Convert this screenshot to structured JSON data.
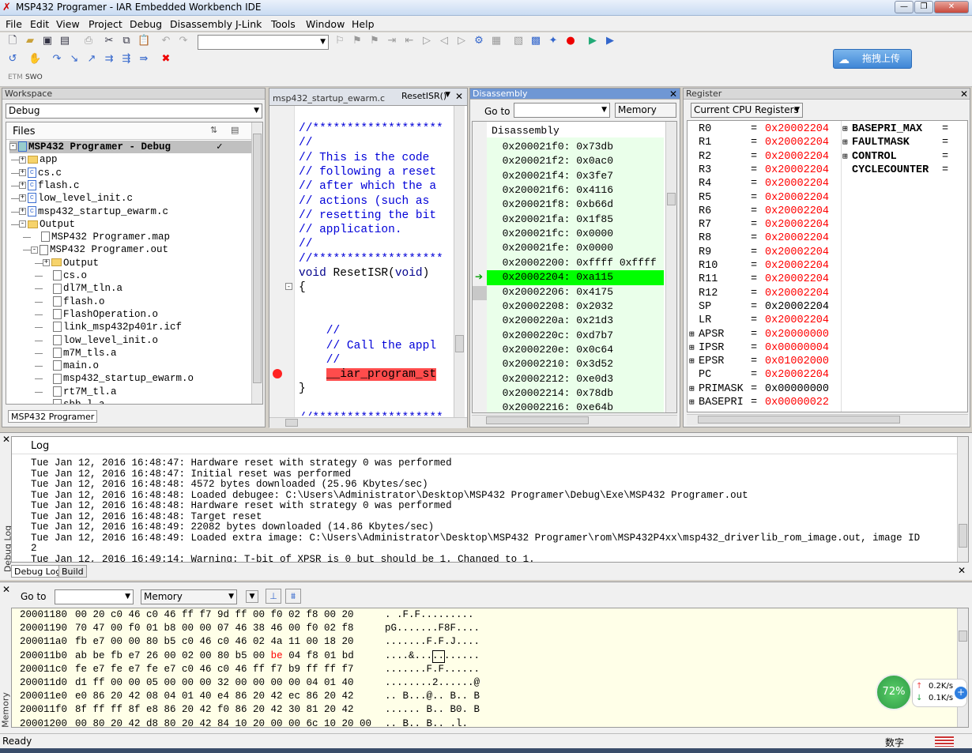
{
  "window": {
    "title": "MSP432 Programer - IAR Embedded Workbench IDE",
    "min": "—",
    "max": "❐",
    "close": "✕"
  },
  "menu": [
    "File",
    "Edit",
    "View",
    "Project",
    "Debug",
    "Disassembly",
    "J-Link",
    "Tools",
    "Window",
    "Help"
  ],
  "upload_button": "拖拽上传",
  "etm_tabs": [
    "ETM",
    "SWO"
  ],
  "workspace": {
    "header": "Workspace",
    "config": "Debug",
    "files_label": "Files",
    "root": "MSP432 Programer - Debug",
    "check": "✓",
    "bottom_tab": "MSP432 Programer",
    "items": [
      {
        "name": "app",
        "kind": "folder",
        "indent": 0,
        "pm": "+"
      },
      {
        "name": "cs.c",
        "kind": "c",
        "indent": 0,
        "pm": "+"
      },
      {
        "name": "flash.c",
        "kind": "c",
        "indent": 0,
        "pm": "+"
      },
      {
        "name": "low_level_init.c",
        "kind": "c",
        "indent": 0,
        "pm": "+"
      },
      {
        "name": "msp432_startup_ewarm.c",
        "kind": "c",
        "indent": 0,
        "pm": "+"
      },
      {
        "name": "Output",
        "kind": "folder",
        "indent": 0,
        "pm": "-"
      },
      {
        "name": "MSP432 Programer.map",
        "kind": "file",
        "indent": 1,
        "pm": ""
      },
      {
        "name": "MSP432 Programer.out",
        "kind": "file",
        "indent": 1,
        "pm": "-"
      },
      {
        "name": "Output",
        "kind": "folder",
        "indent": 2,
        "pm": "+"
      },
      {
        "name": "cs.o",
        "kind": "file",
        "indent": 2,
        "pm": ""
      },
      {
        "name": "dl7M_tln.a",
        "kind": "file",
        "indent": 2,
        "pm": ""
      },
      {
        "name": "flash.o",
        "kind": "file",
        "indent": 2,
        "pm": ""
      },
      {
        "name": "FlashOperation.o",
        "kind": "file",
        "indent": 2,
        "pm": ""
      },
      {
        "name": "link_msp432p401r.icf",
        "kind": "file",
        "indent": 2,
        "pm": ""
      },
      {
        "name": "low_level_init.o",
        "kind": "file",
        "indent": 2,
        "pm": ""
      },
      {
        "name": "m7M_tls.a",
        "kind": "file",
        "indent": 2,
        "pm": ""
      },
      {
        "name": "main.o",
        "kind": "file",
        "indent": 2,
        "pm": ""
      },
      {
        "name": "msp432_startup_ewarm.o",
        "kind": "file",
        "indent": 2,
        "pm": ""
      },
      {
        "name": "rt7M_tl.a",
        "kind": "file",
        "indent": 2,
        "pm": ""
      },
      {
        "name": "shb_l.a",
        "kind": "file",
        "indent": 2,
        "pm": ""
      }
    ]
  },
  "editor": {
    "tab": "msp432_startup_ewarm.c",
    "func_combo": "ResetISR()",
    "close": "✕",
    "lines": [
      {
        "t": "//*******************",
        "c": "cm"
      },
      {
        "t": "//",
        "c": "cm"
      },
      {
        "t": "// This is the code",
        "c": "cm"
      },
      {
        "t": "// following a reset",
        "c": "cm"
      },
      {
        "t": "// after which the a",
        "c": "cm"
      },
      {
        "t": "// actions (such as ",
        "c": "cm"
      },
      {
        "t": "// resetting the bit",
        "c": "cm"
      },
      {
        "t": "// application.",
        "c": "cm"
      },
      {
        "t": "//",
        "c": "cm"
      },
      {
        "t": "//*******************",
        "c": "cm"
      },
      {
        "t": "void ResetISR(void)",
        "c": "kw"
      },
      {
        "t": "{",
        "c": ""
      },
      {
        "t": "",
        "c": ""
      },
      {
        "t": "",
        "c": ""
      },
      {
        "t": "    //",
        "c": "cm"
      },
      {
        "t": "    // Call the appl",
        "c": "cm"
      },
      {
        "t": "    //",
        "c": "cm"
      },
      {
        "t": "    __iar_program_st",
        "c": "bp"
      },
      {
        "t": "}",
        "c": ""
      },
      {
        "t": "",
        "c": ""
      },
      {
        "t": "//*******************",
        "c": "cm"
      }
    ]
  },
  "disassembly": {
    "header": "Disassembly",
    "goto": "Go to",
    "memory_combo": "Memory",
    "title": "Disassembly",
    "rows": [
      "0x200021f0: 0x73db",
      "0x200021f2: 0x0ac0",
      "0x200021f4: 0x3fe7",
      "0x200021f6: 0x4116",
      "0x200021f8: 0xb66d",
      "0x200021fa: 0x1f85",
      "0x200021fc: 0x0000",
      "0x200021fe: 0x0000",
      "0x20002200: 0xffff 0xffff",
      "0x20002204: 0xa115",
      "0x20002206: 0x4175",
      "0x20002208: 0x2032",
      "0x2000220a: 0x21d3",
      "0x2000220c: 0xd7b7",
      "0x2000220e: 0x0c64",
      "0x20002210: 0x3d52",
      "0x20002212: 0xe0d3",
      "0x20002214: 0x78db",
      "0x20002216: 0xe64b"
    ],
    "current": 9
  },
  "registers": {
    "header": "Register",
    "combo": "Current CPU Registers",
    "left": [
      {
        "n": "R0",
        "v": "0x20002204",
        "red": true,
        "pm": ""
      },
      {
        "n": "R1",
        "v": "0x20002204",
        "red": true,
        "pm": ""
      },
      {
        "n": "R2",
        "v": "0x20002204",
        "red": true,
        "pm": ""
      },
      {
        "n": "R3",
        "v": "0x20002204",
        "red": true,
        "pm": ""
      },
      {
        "n": "R4",
        "v": "0x20002204",
        "red": true,
        "pm": ""
      },
      {
        "n": "R5",
        "v": "0x20002204",
        "red": true,
        "pm": ""
      },
      {
        "n": "R6",
        "v": "0x20002204",
        "red": true,
        "pm": ""
      },
      {
        "n": "R7",
        "v": "0x20002204",
        "red": true,
        "pm": ""
      },
      {
        "n": "R8",
        "v": "0x20002204",
        "red": true,
        "pm": ""
      },
      {
        "n": "R9",
        "v": "0x20002204",
        "red": true,
        "pm": ""
      },
      {
        "n": "R10",
        "v": "0x20002204",
        "red": true,
        "pm": ""
      },
      {
        "n": "R11",
        "v": "0x20002204",
        "red": true,
        "pm": ""
      },
      {
        "n": "R12",
        "v": "0x20002204",
        "red": true,
        "pm": ""
      },
      {
        "n": "SP",
        "v": "0x20002204",
        "red": false,
        "pm": ""
      },
      {
        "n": "LR",
        "v": "0x20002204",
        "red": true,
        "pm": ""
      },
      {
        "n": "APSR",
        "v": "0x20000000",
        "red": true,
        "pm": "+"
      },
      {
        "n": "IPSR",
        "v": "0x00000004",
        "red": true,
        "pm": "+"
      },
      {
        "n": "EPSR",
        "v": "0x01002000",
        "red": true,
        "pm": "+"
      },
      {
        "n": "PC",
        "v": "0x20002204",
        "red": true,
        "pm": ""
      },
      {
        "n": "PRIMASK",
        "v": "0x00000000",
        "red": false,
        "pm": "+"
      },
      {
        "n": "BASEPRI",
        "v": "0x00000022",
        "red": true,
        "pm": "+"
      }
    ],
    "right": [
      {
        "n": "BASEPRI_MAX",
        "pm": "+"
      },
      {
        "n": "FAULTMASK",
        "pm": "+"
      },
      {
        "n": "CONTROL",
        "pm": "+"
      },
      {
        "n": "CYCLECOUNTER",
        "pm": ""
      }
    ]
  },
  "log": {
    "title": "Log",
    "side_label": "Debug Log",
    "tabs": [
      "Debug Log",
      "Build"
    ],
    "lines": [
      "Tue Jan 12, 2016 16:48:47: Hardware reset with strategy 0 was performed",
      "Tue Jan 12, 2016 16:48:47: Initial reset was performed",
      "Tue Jan 12, 2016 16:48:48: 4572 bytes downloaded (25.96 Kbytes/sec)",
      "Tue Jan 12, 2016 16:48:48: Loaded debugee: C:\\Users\\Administrator\\Desktop\\MSP432 Programer\\Debug\\Exe\\MSP432 Programer.out",
      "Tue Jan 12, 2016 16:48:48: Hardware reset with strategy 0 was performed",
      "Tue Jan 12, 2016 16:48:48: Target reset",
      "Tue Jan 12, 2016 16:48:49: 22082 bytes downloaded (14.86 Kbytes/sec)",
      "Tue Jan 12, 2016 16:48:49: Loaded extra image: C:\\Users\\Administrator\\Desktop\\MSP432 Programer\\rom\\MSP432P4xx\\msp432_driverlib_rom_image.out, image ID",
      "2",
      "Tue Jan 12, 2016 16:49:14: Warning: T-bit of XPSR is 0 but should be 1. Changed to 1."
    ]
  },
  "memory": {
    "goto": "Go to",
    "combo": "Memory",
    "side_label": "Memory",
    "lines": [
      {
        "a": "20001180",
        "h": "00 20 c0 46 c0 46 ff f7 9d ff 00 f0 02 f8 00 20",
        "s": ". .F.F........."
      },
      {
        "a": "20001190",
        "h": "70 47 00 f0 01 b8 00 00 07 46 38 46 00 f0 02 f8",
        "s": "pG.......F8F...."
      },
      {
        "a": "200011a0",
        "h": "fb e7 00 00 80 b5 c0 46 c0 46 02 4a 11 00 18 20",
        "s": ".......F.F.J...."
      },
      {
        "a": "200011b0",
        "h": "ab be fb e7 26 00 02 00 80 b5 00 be 04 f8 01 bd",
        "s": "....&..........."
      },
      {
        "a": "200011c0",
        "h": "fe e7 fe e7 fe e7 c0 46 c0 46 ff f7 b9 ff ff f7",
        "s": ".......F.F......"
      },
      {
        "a": "200011d0",
        "h": "d1 ff 00 00 05 00 00 00 32 00 00 00 00 04 01 40",
        "s": "........2......@"
      },
      {
        "a": "200011e0",
        "h": "e0 86 20 42 08 04 01 40 e4 86 20 42 ec 86 20 42",
        "s": ".. B...@.. B.. B"
      },
      {
        "a": "200011f0",
        "h": "8f ff ff 8f e8 86 20 42 f0 86 20 42 30 81 20 42",
        "s": "...... B.. B0. B"
      },
      {
        "a": "20001200",
        "h": "00 80 20 42 d8 80 20 42 84 10 20 00 00 6c 10 20 00",
        "s": ".. B.. B.. .l. "
      }
    ]
  },
  "status": {
    "text": "Ready",
    "ime": "数字"
  },
  "netwidget": {
    "percent": "72%",
    "up": "0.2K/s",
    "down": "0.1K/s"
  },
  "colors": {
    "highlight": "#00ff00",
    "current_line_bg": "#eaffea",
    "breakpoint": "#ff2222"
  }
}
